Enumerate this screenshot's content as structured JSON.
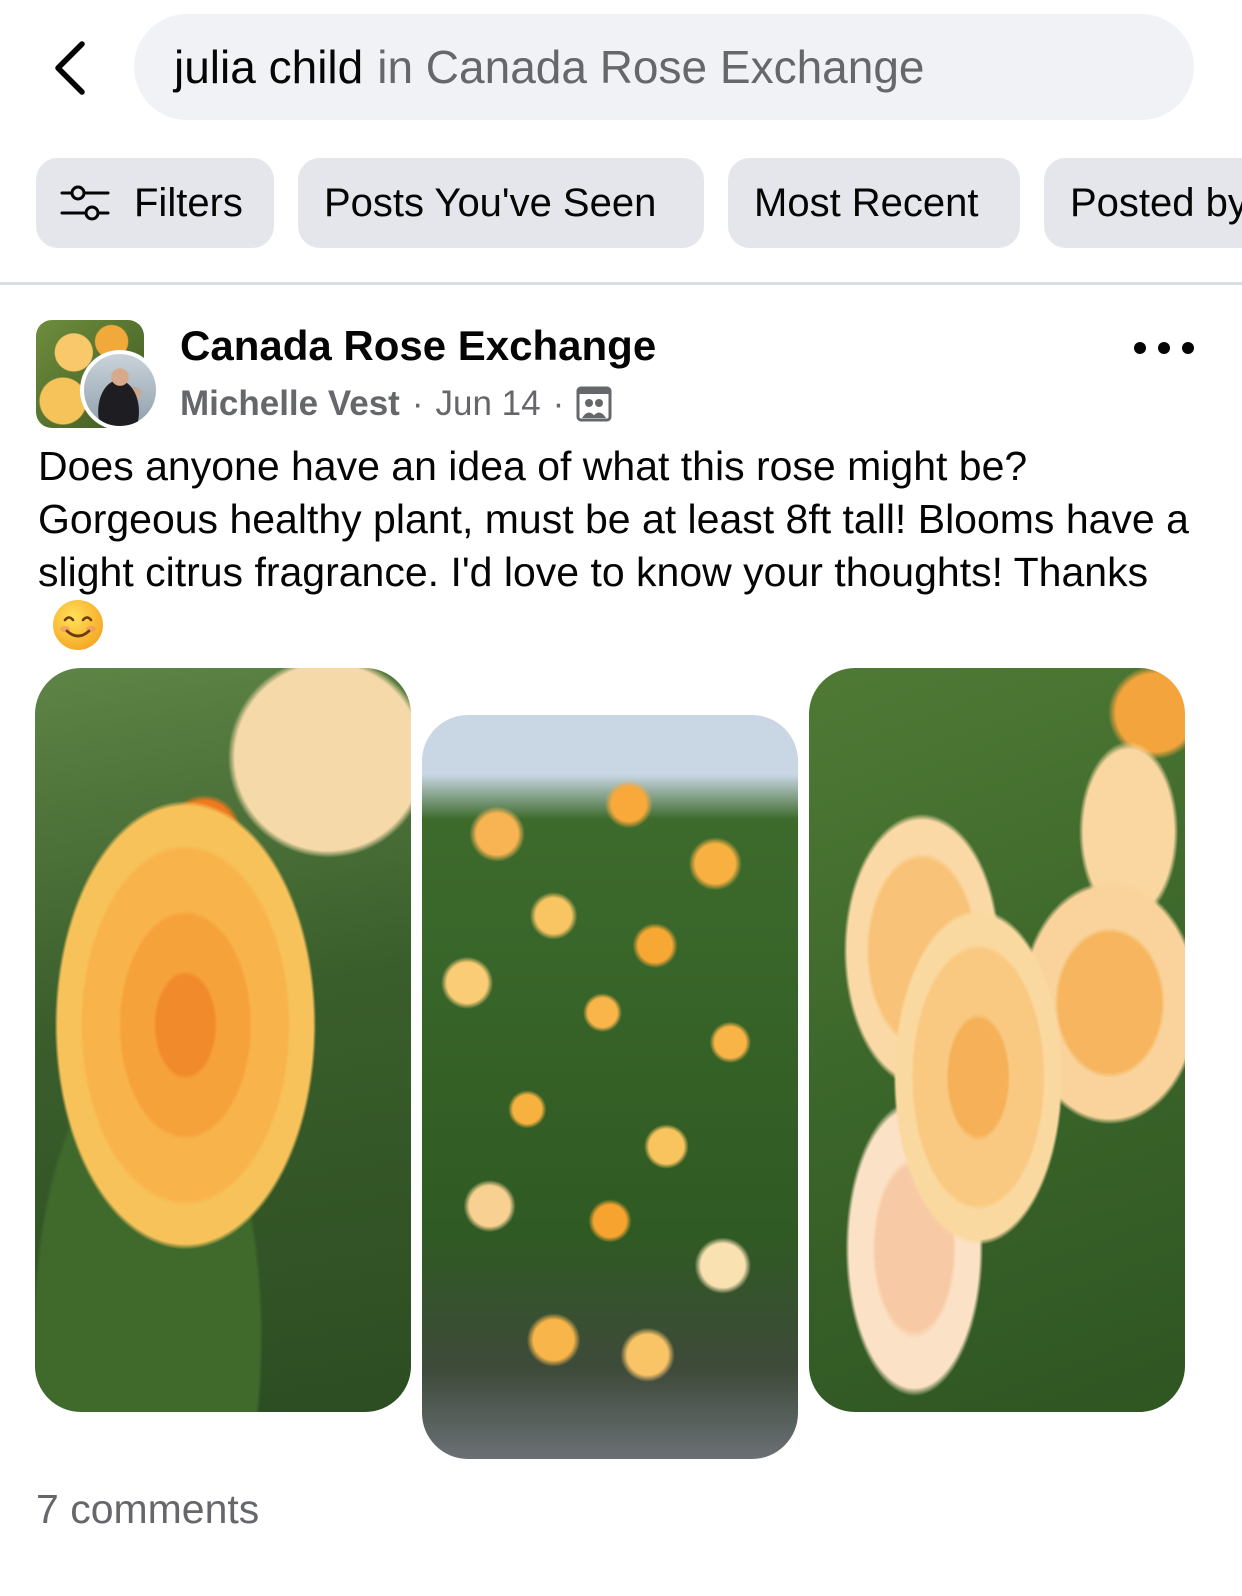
{
  "search": {
    "query": "julia child",
    "scope": "in Canada Rose Exchange"
  },
  "chips": {
    "filters_label": "Filters",
    "seen_label": "Posts You've Seen",
    "recent_label": "Most Recent",
    "posted_label": "Posted by"
  },
  "post": {
    "group_name": "Canada Rose Exchange",
    "author": "Michelle Vest",
    "separator": "·",
    "date": "Jun 14",
    "text": "Does anyone have an idea of what this rose might be? Gorgeous healthy plant, must be at least 8ft tall! Blooms have a slight citrus fragrance. I'd love to know your thoughts! Thanks",
    "emoji": "smiling-face-emoji",
    "photos": [
      "yellow-rose-closeup",
      "rose-bush",
      "rose-cluster"
    ],
    "comments": "7 comments"
  },
  "icons": {
    "back": "chevron-left-icon",
    "filters": "sliders-icon",
    "visibility": "group-members-icon",
    "more": "more-horizontal-icon"
  },
  "colors": {
    "search_background": "#f0f2f5",
    "chip_background": "#e4e6eb",
    "secondary_text": "#65676b",
    "primary_text": "#050505"
  }
}
